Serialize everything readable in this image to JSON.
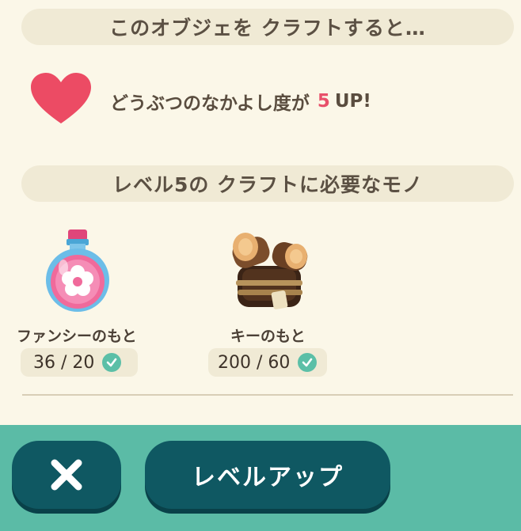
{
  "craft_header": "このオブジェを クラフトすると…",
  "bonus": {
    "prefix": "どうぶつのなかよし度が",
    "amount": "5",
    "suffix": "UP!",
    "heart_color": "#ec4b64"
  },
  "materials_header": "レベル5の クラフトに必要なモノ",
  "materials": [
    {
      "name": "ファンシーのもと",
      "count": "36 / 20",
      "icon": "potion-icon",
      "satisfied": true
    },
    {
      "name": "キーのもと",
      "count": "200 / 60",
      "icon": "wood-logs-icon",
      "satisfied": true
    }
  ],
  "buttons": {
    "close_icon": "close-icon",
    "level_up_label": "レベルアップ"
  },
  "colors": {
    "accent_teal": "#5bbba6",
    "button_dark": "#0f5862",
    "highlight_pink": "#e8506a"
  }
}
